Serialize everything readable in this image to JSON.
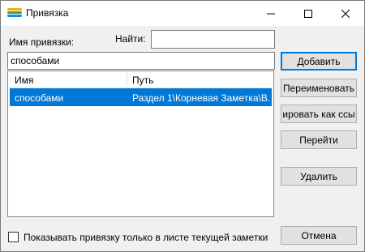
{
  "window": {
    "title": "Привязка"
  },
  "form": {
    "name_label": "Имя привязки:",
    "search_label": "Найти:",
    "search_value": "",
    "name_value": "способами"
  },
  "list": {
    "columns": [
      "Имя",
      "Путь"
    ],
    "rows": [
      {
        "name": "способами",
        "path": "Раздел 1\\Корневая Заметка\\В...",
        "selected": true
      }
    ]
  },
  "buttons": {
    "add": "Добавить",
    "rename": "Переименовать",
    "copy_as_link": "ировать как ссы",
    "go": "Перейти",
    "delete": "Удалить",
    "cancel": "Отмена"
  },
  "checkbox": {
    "label": "Показывать привязку только в листе текущей заметки",
    "checked": false
  },
  "colors": {
    "selection": "#0078d7",
    "accent": "#0078d7"
  },
  "icons": [
    "app-logo-icon",
    "minimize-icon",
    "maximize-icon",
    "close-icon"
  ]
}
